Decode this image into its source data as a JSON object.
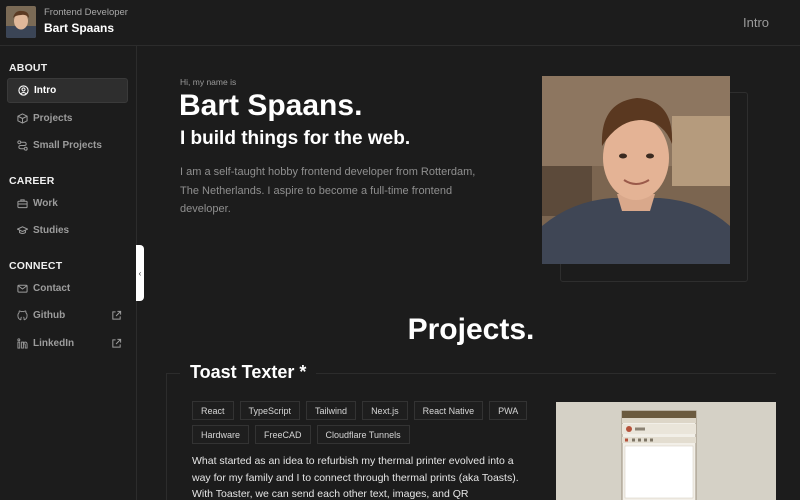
{
  "header": {
    "role": "Frontend Developer",
    "name": "Bart Spaans",
    "current_section": "Intro"
  },
  "sidebar": {
    "groups": [
      {
        "title": "ABOUT",
        "items": [
          {
            "label": "Intro",
            "icon": "user-circle-icon",
            "active": true
          },
          {
            "label": "Projects",
            "icon": "cube-icon"
          },
          {
            "label": "Small Projects",
            "icon": "route-icon"
          }
        ]
      },
      {
        "title": "CAREER",
        "items": [
          {
            "label": "Work",
            "icon": "briefcase-icon"
          },
          {
            "label": "Studies",
            "icon": "graduation-cap-icon"
          }
        ]
      },
      {
        "title": "CONNECT",
        "items": [
          {
            "label": "Contact",
            "icon": "mail-icon"
          },
          {
            "label": "Github",
            "icon": "github-icon",
            "external": true
          },
          {
            "label": "LinkedIn",
            "icon": "linkedin-icon",
            "external": true
          }
        ]
      }
    ],
    "collapse_glyph": "‹"
  },
  "hero": {
    "greeting": "Hi, my name is",
    "name": "Bart Spaans.",
    "tagline": "I build things for the web.",
    "bio": "I am a self-taught hobby frontend developer from Rotterdam, The Netherlands. I aspire to become a full-time frontend developer."
  },
  "projects": {
    "heading": "Projects.",
    "items": [
      {
        "title": "Toast Texter *",
        "tags": [
          "React",
          "TypeScript",
          "Tailwind",
          "Next.js",
          "React Native",
          "PWA",
          "Hardware",
          "FreeCAD",
          "Cloudflare Tunnels"
        ],
        "description": "What started as an idea to refurbish my thermal printer evolved into a way for my family and I to connect through thermal prints (aka Toasts). With Toaster, we can send each other text, images, and QR"
      }
    ]
  },
  "colors": {
    "background": "#1c1c1c",
    "active_nav": "#2e2e2e",
    "muted_text": "#8f8f8f"
  }
}
